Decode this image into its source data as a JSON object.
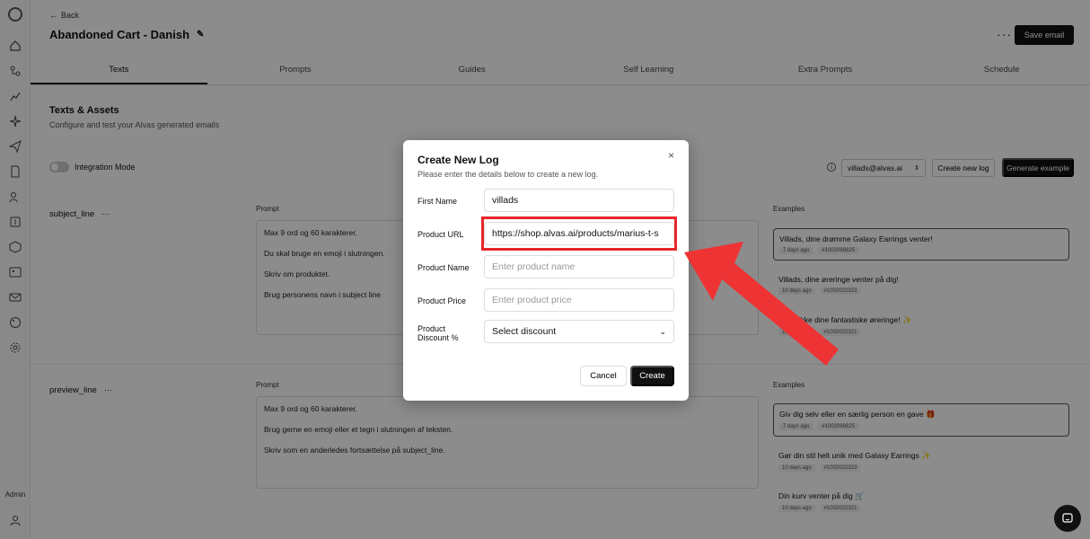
{
  "header": {
    "back_label": "Back",
    "title": "Abandoned Cart - Danish",
    "save_label": "Save email",
    "more": "···"
  },
  "tabs": [
    {
      "label": "Texts"
    },
    {
      "label": "Prompts"
    },
    {
      "label": "Guides"
    },
    {
      "label": "Self Learning"
    },
    {
      "label": "Extra Prompts"
    },
    {
      "label": "Schedule"
    }
  ],
  "section": {
    "title": "Texts & Assets",
    "subtitle": "Configure and test your Alvas generated emails"
  },
  "toolbar": {
    "integration_label": "Integration Mode",
    "email": "villads@alvas.ai",
    "create_log_label": "Create new log",
    "generate_label": "Generate example"
  },
  "sidebar": {
    "admin_label": "Admin"
  },
  "rows": [
    {
      "label": "subject_line",
      "prompt_head": "Prompt",
      "examples_head": "Examples",
      "prompt_lines": [
        "Max 9 ord og 60 karakterer.",
        "Du skal bruge en emoji i slutningen.",
        "Skriv om produktet.",
        "Brug personens navn i subject line"
      ],
      "examples": [
        {
          "text": "Villads, dine drømme Galaxy Earrings venter!",
          "age": "7 days ago",
          "id": "#1002068825"
        },
        {
          "text": "Villads, dine øreringe venter på dig!",
          "age": "10 days ago",
          "id": "#1002022323"
        },
        {
          "text": "Glem ikke dine fantastiske øreringe! ✨",
          "age": "10 days ago",
          "id": "#1002022321"
        }
      ]
    },
    {
      "label": "preview_line",
      "prompt_head": "Prompt",
      "examples_head": "Examples",
      "prompt_lines": [
        "Max 9 ord og 60 karakterer.",
        "Brug gerne en emoji eller et tegn i slutningen af teksten.",
        "Skriv som en anderledes fortsættelse på subject_line."
      ],
      "examples": [
        {
          "text": "Giv dig selv eller en særlig person en gave 🎁",
          "age": "7 days ago",
          "id": "#1002068825"
        },
        {
          "text": "Gør din stil helt unik med Galaxy Earrings ✨",
          "age": "10 days ago",
          "id": "#1002022323"
        },
        {
          "text": "Din kurv venter på dig 🛒",
          "age": "10 days ago",
          "id": "#1002022321"
        }
      ]
    }
  ],
  "modal": {
    "title": "Create New Log",
    "subtitle": "Please enter the details below to create a new log.",
    "close": "×",
    "fields": {
      "first_name": {
        "label": "First Name",
        "value": "villads",
        "placeholder": ""
      },
      "product_url": {
        "label": "Product URL",
        "value": "https://shop.alvas.ai/products/marius-t-s",
        "placeholder": ""
      },
      "product_name": {
        "label": "Product Name",
        "value": "",
        "placeholder": "Enter product name"
      },
      "product_price": {
        "label": "Product Price",
        "value": "",
        "placeholder": "Enter product price"
      },
      "discount": {
        "label_1": "Product",
        "label_2": "Discount %",
        "selected": "Select discount"
      }
    },
    "cancel_label": "Cancel",
    "create_label": "Create"
  },
  "colors": {
    "accent": "#111111",
    "annotation": "#e8262a"
  }
}
